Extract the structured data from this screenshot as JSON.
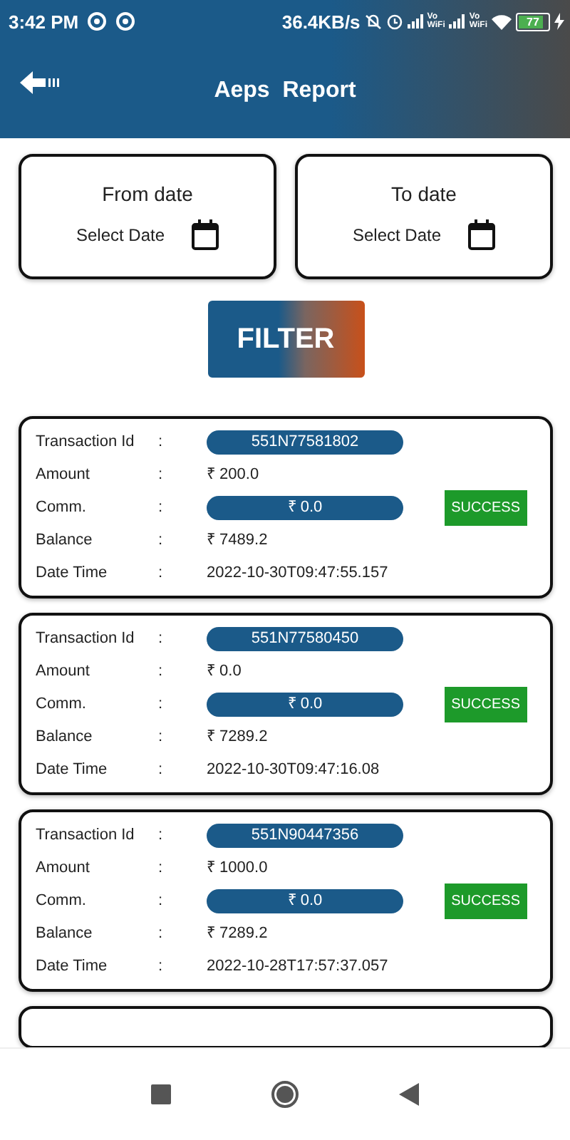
{
  "status_bar": {
    "time": "3:42 PM",
    "speed": "36.4KB/s",
    "volte": [
      {
        "top": "Vo",
        "bottom": "WiFi"
      },
      {
        "top": "Vo",
        "bottom": "WiFi"
      }
    ],
    "battery": "77"
  },
  "app_bar": {
    "title": "Aeps  Report"
  },
  "date_filters": [
    {
      "label": "From date",
      "placeholder": "Select Date"
    },
    {
      "label": "To date",
      "placeholder": "Select Date"
    }
  ],
  "filter_button": "FILTER",
  "transactions": [
    {
      "status": "SUCCESS",
      "fields": [
        {
          "label": "Transaction Id",
          "sep": ":",
          "value": "551N77581802",
          "kind": "pill"
        },
        {
          "label": "Amount",
          "sep": ":",
          "value": "₹ 200.0",
          "kind": "plain"
        },
        {
          "label": "Comm.",
          "sep": ":",
          "value": "₹ 0.0",
          "kind": "pill"
        },
        {
          "label": "Balance",
          "sep": ":",
          "value": "₹ 7489.2",
          "kind": "plain"
        },
        {
          "label": "Date Time",
          "sep": ":",
          "value": "2022-10-30T09:47:55.157",
          "kind": "plain"
        }
      ]
    },
    {
      "status": "SUCCESS",
      "fields": [
        {
          "label": "Transaction Id",
          "sep": ":",
          "value": "551N77580450",
          "kind": "pill"
        },
        {
          "label": "Amount",
          "sep": ":",
          "value": "₹ 0.0",
          "kind": "plain"
        },
        {
          "label": "Comm.",
          "sep": ":",
          "value": "₹ 0.0",
          "kind": "pill"
        },
        {
          "label": "Balance",
          "sep": ":",
          "value": "₹ 7289.2",
          "kind": "plain"
        },
        {
          "label": "Date Time",
          "sep": ":",
          "value": "2022-10-30T09:47:16.08",
          "kind": "plain"
        }
      ]
    },
    {
      "status": "SUCCESS",
      "fields": [
        {
          "label": "Transaction Id",
          "sep": ":",
          "value": "551N90447356",
          "kind": "pill"
        },
        {
          "label": "Amount",
          "sep": ":",
          "value": "₹ 1000.0",
          "kind": "plain"
        },
        {
          "label": "Comm.",
          "sep": ":",
          "value": "₹ 0.0",
          "kind": "pill"
        },
        {
          "label": "Balance",
          "sep": ":",
          "value": "₹ 7289.2",
          "kind": "plain"
        },
        {
          "label": "Date Time",
          "sep": ":",
          "value": "2022-10-28T17:57:37.057",
          "kind": "plain"
        }
      ]
    }
  ]
}
